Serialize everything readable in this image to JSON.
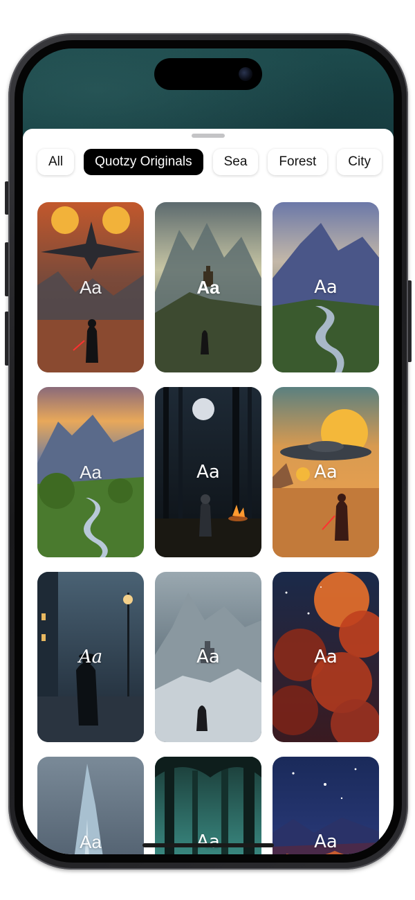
{
  "filters": {
    "chips": [
      {
        "label": "All",
        "active": false
      },
      {
        "label": "Quotzy Originals",
        "active": true
      },
      {
        "label": "Sea",
        "active": false
      },
      {
        "label": "Forest",
        "active": false
      },
      {
        "label": "City",
        "active": false
      }
    ]
  },
  "themes": [
    {
      "label": "Aa",
      "subject": "starship-twin-suns-desert"
    },
    {
      "label": "Aa",
      "subject": "castle-mountain-wanderer"
    },
    {
      "label": "Aa",
      "subject": "mountain-valley-river"
    },
    {
      "label": "Aa",
      "subject": "green-valley-stream-sunset"
    },
    {
      "label": "Aa",
      "subject": "moonlit-forest-campfire"
    },
    {
      "label": "Aa",
      "subject": "saucer-sunset-desert"
    },
    {
      "label": "Aa",
      "subject": "rainy-city-street-lamp"
    },
    {
      "label": "Aa",
      "subject": "snowy-castle-traveler"
    },
    {
      "label": "Aa",
      "subject": "fiery-nebula-clouds"
    },
    {
      "label": "Aa",
      "subject": "ice-spire-storm"
    },
    {
      "label": "Aa",
      "subject": "teal-forest-trees"
    },
    {
      "label": "Aa",
      "subject": "night-sky-lava-plain"
    }
  ],
  "colors": {
    "chip_active_bg": "#000000",
    "sheet_bg": "#ffffff",
    "wallpaper": "#163a3e"
  }
}
